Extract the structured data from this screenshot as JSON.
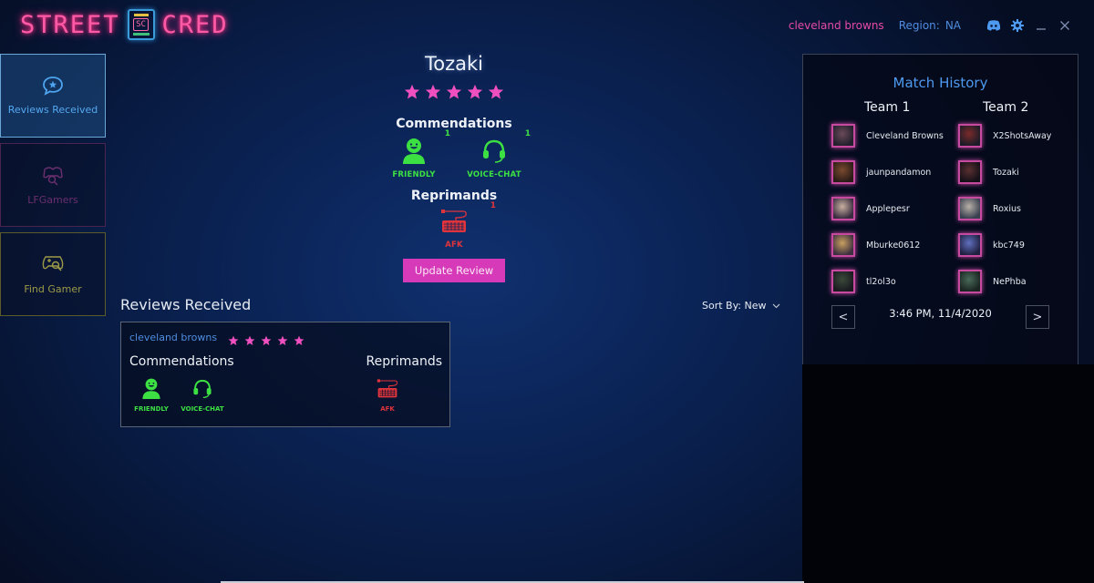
{
  "app": {
    "logo_left": "STREET",
    "logo_badge": "SC",
    "logo_right": "CRED"
  },
  "topbar": {
    "username": "cleveland browns",
    "region_label": "Region:",
    "region_value": "NA",
    "icons": [
      "discord-icon",
      "gear-icon",
      "minimize-icon",
      "close-icon"
    ]
  },
  "sidebar": {
    "items": [
      {
        "label": "Reviews Received",
        "icon": "star-chat-bubble-icon",
        "active": true
      },
      {
        "label": "LFGamers",
        "icon": "gamers-group-icon",
        "active": false
      },
      {
        "label": "Find Gamer",
        "icon": "controller-search-icon",
        "active": false
      }
    ]
  },
  "profile": {
    "name": "Tozaki",
    "rating": 5,
    "rating_max": 5,
    "commendations_title": "Commendations",
    "commendations": [
      {
        "label": "FRIENDLY",
        "icon": "smiley-person-icon",
        "count": "1"
      },
      {
        "label": "VOICE-CHAT",
        "icon": "headset-icon",
        "count": "1"
      }
    ],
    "reprimands_title": "Reprimands",
    "reprimands": [
      {
        "label": "AFK",
        "icon": "keyboard-icon",
        "count": "1"
      }
    ],
    "update_button": "Update Review"
  },
  "reviews": {
    "title": "Reviews Received",
    "sort_label": "Sort By: New",
    "items": [
      {
        "reviewer": "cleveland browns",
        "rating": 5,
        "commendations_title": "Commendations",
        "commendations": [
          "FRIENDLY",
          "VOICE-CHAT"
        ],
        "reprimands_title": "Reprimands",
        "reprimands": [
          "AFK"
        ]
      }
    ]
  },
  "match_history": {
    "title": "Match History",
    "team1_label": "Team 1",
    "team2_label": "Team 2",
    "team1": [
      "Cleveland Browns",
      "jaunpandamon",
      "Applepesr",
      "Mburke0612",
      "tl2ol3o"
    ],
    "team2": [
      "X2ShotsAway",
      "Tozaki",
      "Roxius",
      "kbc749",
      "NePhba"
    ],
    "timestamp": "3:46 PM, 11/4/2020",
    "prev_label": "<",
    "next_label": ">"
  },
  "colors": {
    "accent_pink": "#d63ab9",
    "star_pink": "#f04fc0",
    "commend_green": "#3ce043",
    "reprimand_red": "#e0343c",
    "link_blue": "#4e8de0"
  }
}
